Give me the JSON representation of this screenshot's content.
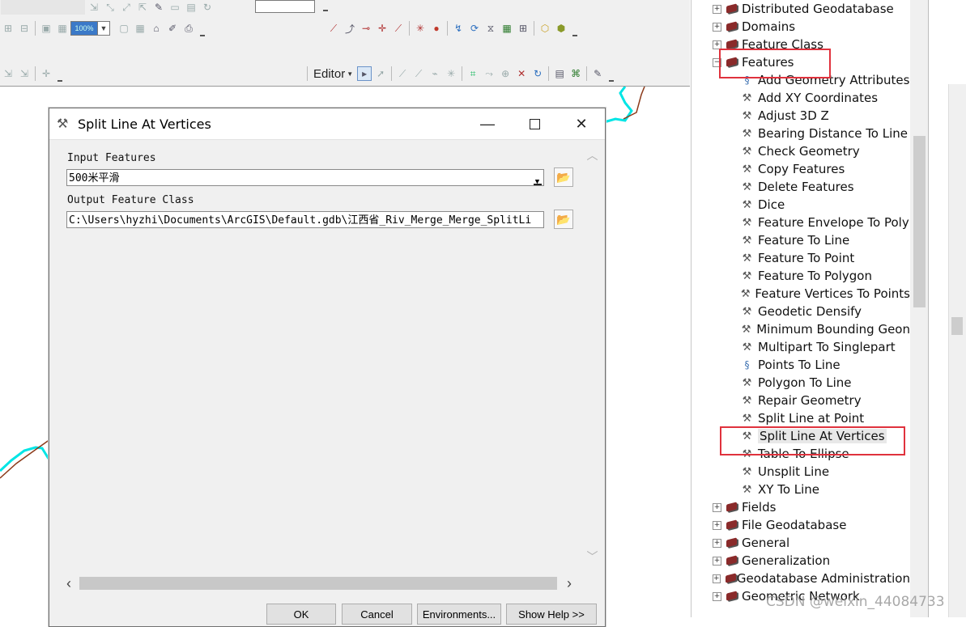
{
  "toolbar": {
    "scale_combo": "100%",
    "editor_label": "Editor"
  },
  "catalog": {
    "items": [
      {
        "label": "Distributed Geodatabase",
        "kind": "toolset",
        "expander": "+"
      },
      {
        "label": "Domains",
        "kind": "toolset",
        "expander": "+"
      },
      {
        "label": "Feature Class",
        "kind": "toolset",
        "expander": "+"
      },
      {
        "label": "Features",
        "kind": "toolset",
        "expander": "−"
      },
      {
        "label": "Add Geometry Attributes",
        "kind": "script"
      },
      {
        "label": "Add XY Coordinates",
        "kind": "tool"
      },
      {
        "label": "Adjust 3D Z",
        "kind": "tool"
      },
      {
        "label": "Bearing Distance To Line",
        "kind": "tool"
      },
      {
        "label": "Check Geometry",
        "kind": "tool"
      },
      {
        "label": "Copy Features",
        "kind": "tool"
      },
      {
        "label": "Delete Features",
        "kind": "tool"
      },
      {
        "label": "Dice",
        "kind": "tool"
      },
      {
        "label": "Feature Envelope To Poly",
        "kind": "tool"
      },
      {
        "label": "Feature To Line",
        "kind": "tool"
      },
      {
        "label": "Feature To Point",
        "kind": "tool"
      },
      {
        "label": "Feature To Polygon",
        "kind": "tool"
      },
      {
        "label": "Feature Vertices To Points",
        "kind": "tool"
      },
      {
        "label": "Geodetic Densify",
        "kind": "tool"
      },
      {
        "label": "Minimum Bounding Geon",
        "kind": "tool"
      },
      {
        "label": "Multipart To Singlepart",
        "kind": "tool"
      },
      {
        "label": "Points To Line",
        "kind": "script"
      },
      {
        "label": "Polygon To Line",
        "kind": "tool"
      },
      {
        "label": "Repair Geometry",
        "kind": "tool"
      },
      {
        "label": "Split Line at Point",
        "kind": "tool"
      },
      {
        "label": "Split Line At Vertices",
        "kind": "tool",
        "selected": true
      },
      {
        "label": "Table To Ellipse",
        "kind": "tool"
      },
      {
        "label": "Unsplit Line",
        "kind": "tool"
      },
      {
        "label": "XY To Line",
        "kind": "tool"
      },
      {
        "label": "Fields",
        "kind": "toolset",
        "expander": "+"
      },
      {
        "label": "File Geodatabase",
        "kind": "toolset",
        "expander": "+"
      },
      {
        "label": "General",
        "kind": "toolset",
        "expander": "+"
      },
      {
        "label": "Generalization",
        "kind": "toolset",
        "expander": "+"
      },
      {
        "label": "Geodatabase Administration",
        "kind": "toolset",
        "expander": "+"
      },
      {
        "label": "Geometric Network",
        "kind": "toolset",
        "expander": "+"
      }
    ]
  },
  "dialog": {
    "title": "Split Line At Vertices",
    "input_features_label": "Input Features",
    "input_features_value": "500米平滑",
    "output_class_label": "Output Feature Class",
    "output_class_value": "C:\\Users\\hyzhi\\Documents\\ArcGIS\\Default.gdb\\江西省_Riv_Merge_Merge_SplitLi",
    "buttons": {
      "ok": "OK",
      "cancel": "Cancel",
      "environments": "Environments...",
      "show_help": "Show Help >>"
    }
  },
  "watermark": "CSDN @weixin_44084733",
  "colors": {
    "highlight_box": "#e0323d",
    "river_line": "#00e5e5",
    "boundary_line": "#8b3a1a"
  }
}
